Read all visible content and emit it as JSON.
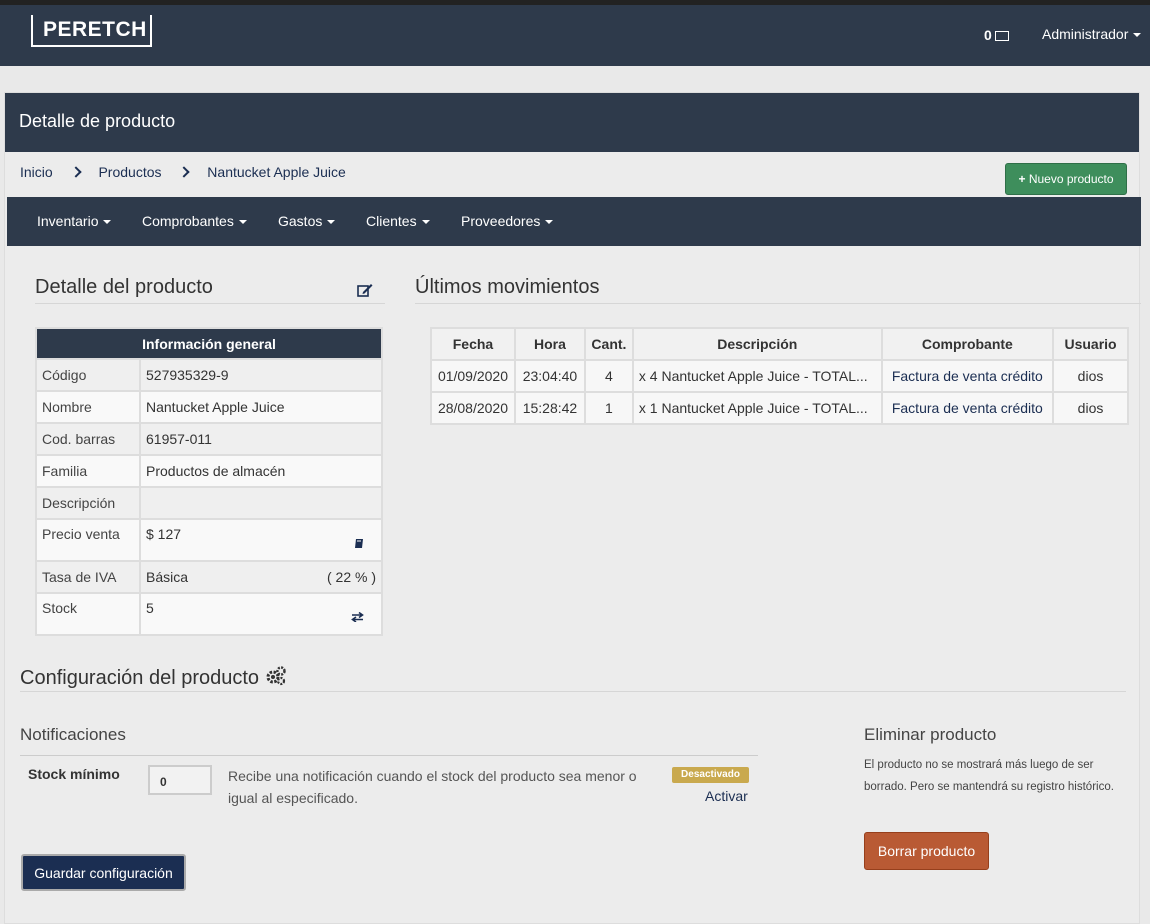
{
  "topbar": {
    "brand": "PERETCH",
    "messages_count": "0",
    "user_menu": "Administrador"
  },
  "panel": {
    "title": "Detalle de producto",
    "breadcrumb": [
      "Inicio",
      "Productos",
      "Nantucket Apple Juice"
    ],
    "new_product_button": "Nuevo producto"
  },
  "menu": [
    "Inventario",
    "Comprobantes",
    "Gastos",
    "Clientes",
    "Proveedores"
  ],
  "detail": {
    "heading": "Detalle del producto",
    "table_header": "Información general",
    "rows": [
      {
        "label": "Código",
        "value": "527935329-9"
      },
      {
        "label": "Nombre",
        "value": "Nantucket Apple Juice"
      },
      {
        "label": "Cod. barras",
        "value": "61957-011"
      },
      {
        "label": "Familia",
        "value": "Productos de almacén"
      },
      {
        "label": "Descripción",
        "value": ""
      },
      {
        "label": "Precio venta",
        "value": "$ 127"
      },
      {
        "label": "Tasa de IVA",
        "value": "Básica",
        "extra": "( 22 % )"
      },
      {
        "label": "Stock",
        "value": "5"
      }
    ]
  },
  "movements": {
    "heading": "Últimos movimientos",
    "columns": [
      "Fecha",
      "Hora",
      "Cant.",
      "Descripción",
      "Comprobante",
      "Usuario"
    ],
    "rows": [
      {
        "fecha": "01/09/2020",
        "hora": "23:04:40",
        "cant": "4",
        "descripcion": "x 4 Nantucket Apple Juice - TOTAL...",
        "comprobante": "Factura de venta crédito",
        "usuario": "dios"
      },
      {
        "fecha": "28/08/2020",
        "hora": "15:28:42",
        "cant": "1",
        "descripcion": "x 1 Nantucket Apple Juice - TOTAL...",
        "comprobante": "Factura de venta crédito",
        "usuario": "dios"
      }
    ]
  },
  "config": {
    "heading": "Configuración del producto",
    "notifications_heading": "Notificaciones",
    "stock_min_label": "Stock mínimo",
    "stock_min_value": "0",
    "stock_help": "Recibe una notificación cuando el stock del producto sea menor o igual al especificado.",
    "status_badge": "Desactivado",
    "activate_link": "Activar",
    "save_button": "Guardar configuración",
    "delete_heading": "Eliminar producto",
    "delete_help": "El producto no se mostrará más luego de ser borrado. Pero se mantendrá su registro histórico.",
    "delete_button": "Borrar producto"
  },
  "colors": {
    "navbar": "#2e3a4b",
    "primary": "#1b2e52",
    "success": "#3e8e5c",
    "danger": "#b95a34",
    "warning": "#c9a94e"
  }
}
